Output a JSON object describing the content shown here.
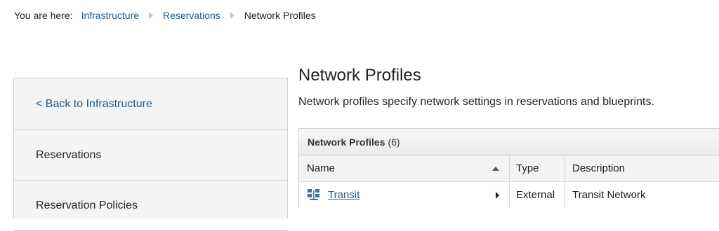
{
  "breadcrumb": {
    "prefix": "You are here:",
    "items": [
      "Infrastructure",
      "Reservations"
    ],
    "current": "Network Profiles"
  },
  "sidebar": {
    "back_label": "< Back to Infrastructure",
    "items": [
      {
        "label": "Reservations"
      },
      {
        "label": "Reservation Policies"
      }
    ]
  },
  "main": {
    "title": "Network Profiles",
    "description": "Network profiles specify network settings in reservations and blueprints."
  },
  "grid": {
    "title": "Network Profiles",
    "count": "(6)",
    "columns": {
      "name": "Name",
      "type": "Type",
      "description": "Description"
    },
    "rows": [
      {
        "name": "Transit",
        "type": "External",
        "description": "Transit Network",
        "icon": "network-icon"
      }
    ]
  },
  "colors": {
    "link": "#1d5a8c",
    "sidebar_bg": "#f4f4f4",
    "border": "#d0d0d0"
  }
}
